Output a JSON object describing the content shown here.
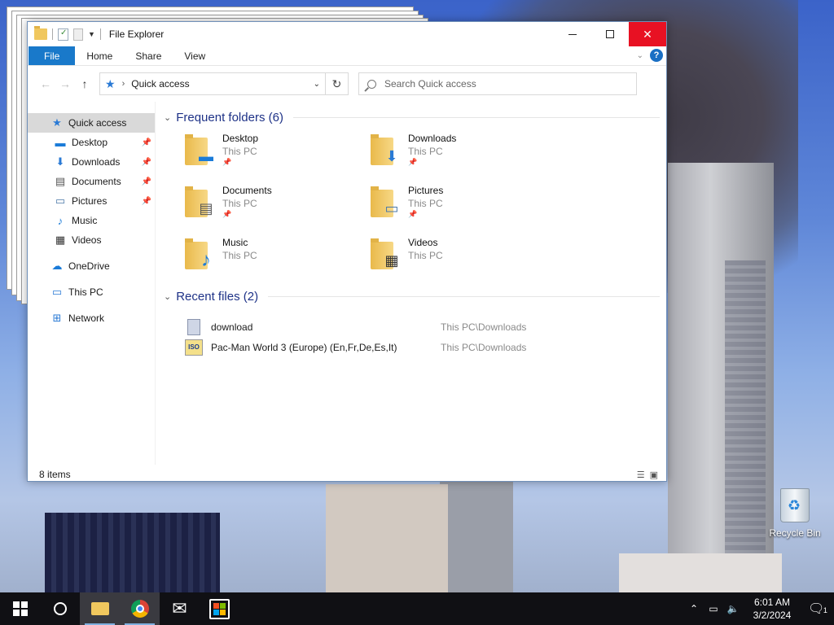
{
  "window": {
    "title": "File Explorer",
    "ribbon_tabs": [
      "File",
      "Home",
      "Share",
      "View"
    ],
    "help": "?",
    "address": {
      "location": "Quick access"
    },
    "search": {
      "placeholder": "Search Quick access"
    },
    "status": "8 items"
  },
  "nav_pane": {
    "quick_access": "Quick access",
    "items": [
      {
        "label": "Desktop",
        "icon": "desktop-icon",
        "pinned": true
      },
      {
        "label": "Downloads",
        "icon": "download-icon",
        "pinned": true
      },
      {
        "label": "Documents",
        "icon": "document-icon",
        "pinned": true
      },
      {
        "label": "Pictures",
        "icon": "picture-icon",
        "pinned": true
      },
      {
        "label": "Music",
        "icon": "music-icon",
        "pinned": false
      },
      {
        "label": "Videos",
        "icon": "video-icon",
        "pinned": false
      }
    ],
    "onedrive": "OneDrive",
    "this_pc": "This PC",
    "network": "Network"
  },
  "frequent": {
    "header": "Frequent folders (6)",
    "folders": [
      {
        "name": "Desktop",
        "location": "This PC",
        "pinned": true
      },
      {
        "name": "Downloads",
        "location": "This PC",
        "pinned": true
      },
      {
        "name": "Documents",
        "location": "This PC",
        "pinned": true
      },
      {
        "name": "Pictures",
        "location": "This PC",
        "pinned": true
      },
      {
        "name": "Music",
        "location": "This PC",
        "pinned": false
      },
      {
        "name": "Videos",
        "location": "This PC",
        "pinned": false
      }
    ]
  },
  "recent": {
    "header": "Recent files (2)",
    "files": [
      {
        "name": "download",
        "path": "This PC\\Downloads"
      },
      {
        "name": "Pac-Man World 3 (Europe) (En,Fr,De,Es,It)",
        "path": "This PC\\Downloads"
      }
    ]
  },
  "desktop": {
    "recycle_bin": "Recycle Bin"
  },
  "taskbar": {
    "time": "6:01 AM",
    "date": "3/2/2024",
    "notification_count": "1"
  },
  "colors": {
    "accent": "#1979ca",
    "close": "#e81123",
    "header_text": "#1e3287"
  }
}
